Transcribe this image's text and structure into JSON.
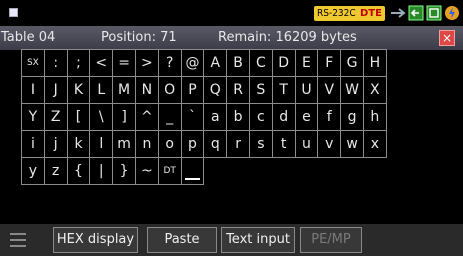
{
  "status": {
    "port": "RS-232C",
    "mode": "DTE"
  },
  "title": {
    "table": "Table 04",
    "position": "Position: 71",
    "remain": "Remain: 16209 bytes",
    "close": "×"
  },
  "keys": [
    [
      "SX",
      ":",
      ";",
      "<",
      "=",
      ">",
      "?",
      "@",
      "A",
      "B",
      "C",
      "D",
      "E",
      "F",
      "G",
      "H"
    ],
    [
      "I",
      "J",
      "K",
      "L",
      "M",
      "N",
      "O",
      "P",
      "Q",
      "R",
      "S",
      "T",
      "U",
      "V",
      "W",
      "X"
    ],
    [
      "Y",
      "Z",
      "[",
      "\\",
      "]",
      "^",
      "_",
      "`",
      "a",
      "b",
      "c",
      "d",
      "e",
      "f",
      "g",
      "h"
    ],
    [
      "i",
      "j",
      "k",
      "l",
      "m",
      "n",
      "o",
      "p",
      "q",
      "r",
      "s",
      "t",
      "u",
      "v",
      "w",
      "x"
    ],
    [
      "y",
      "z",
      "{",
      "|",
      "}",
      "~",
      "DT",
      ""
    ]
  ],
  "toolbar": {
    "hex": "HEX display",
    "paste": "Paste",
    "text": "Text input",
    "pemp": "PE/MP"
  },
  "colors": {
    "accent": "#f0c830",
    "close": "#e04848"
  }
}
